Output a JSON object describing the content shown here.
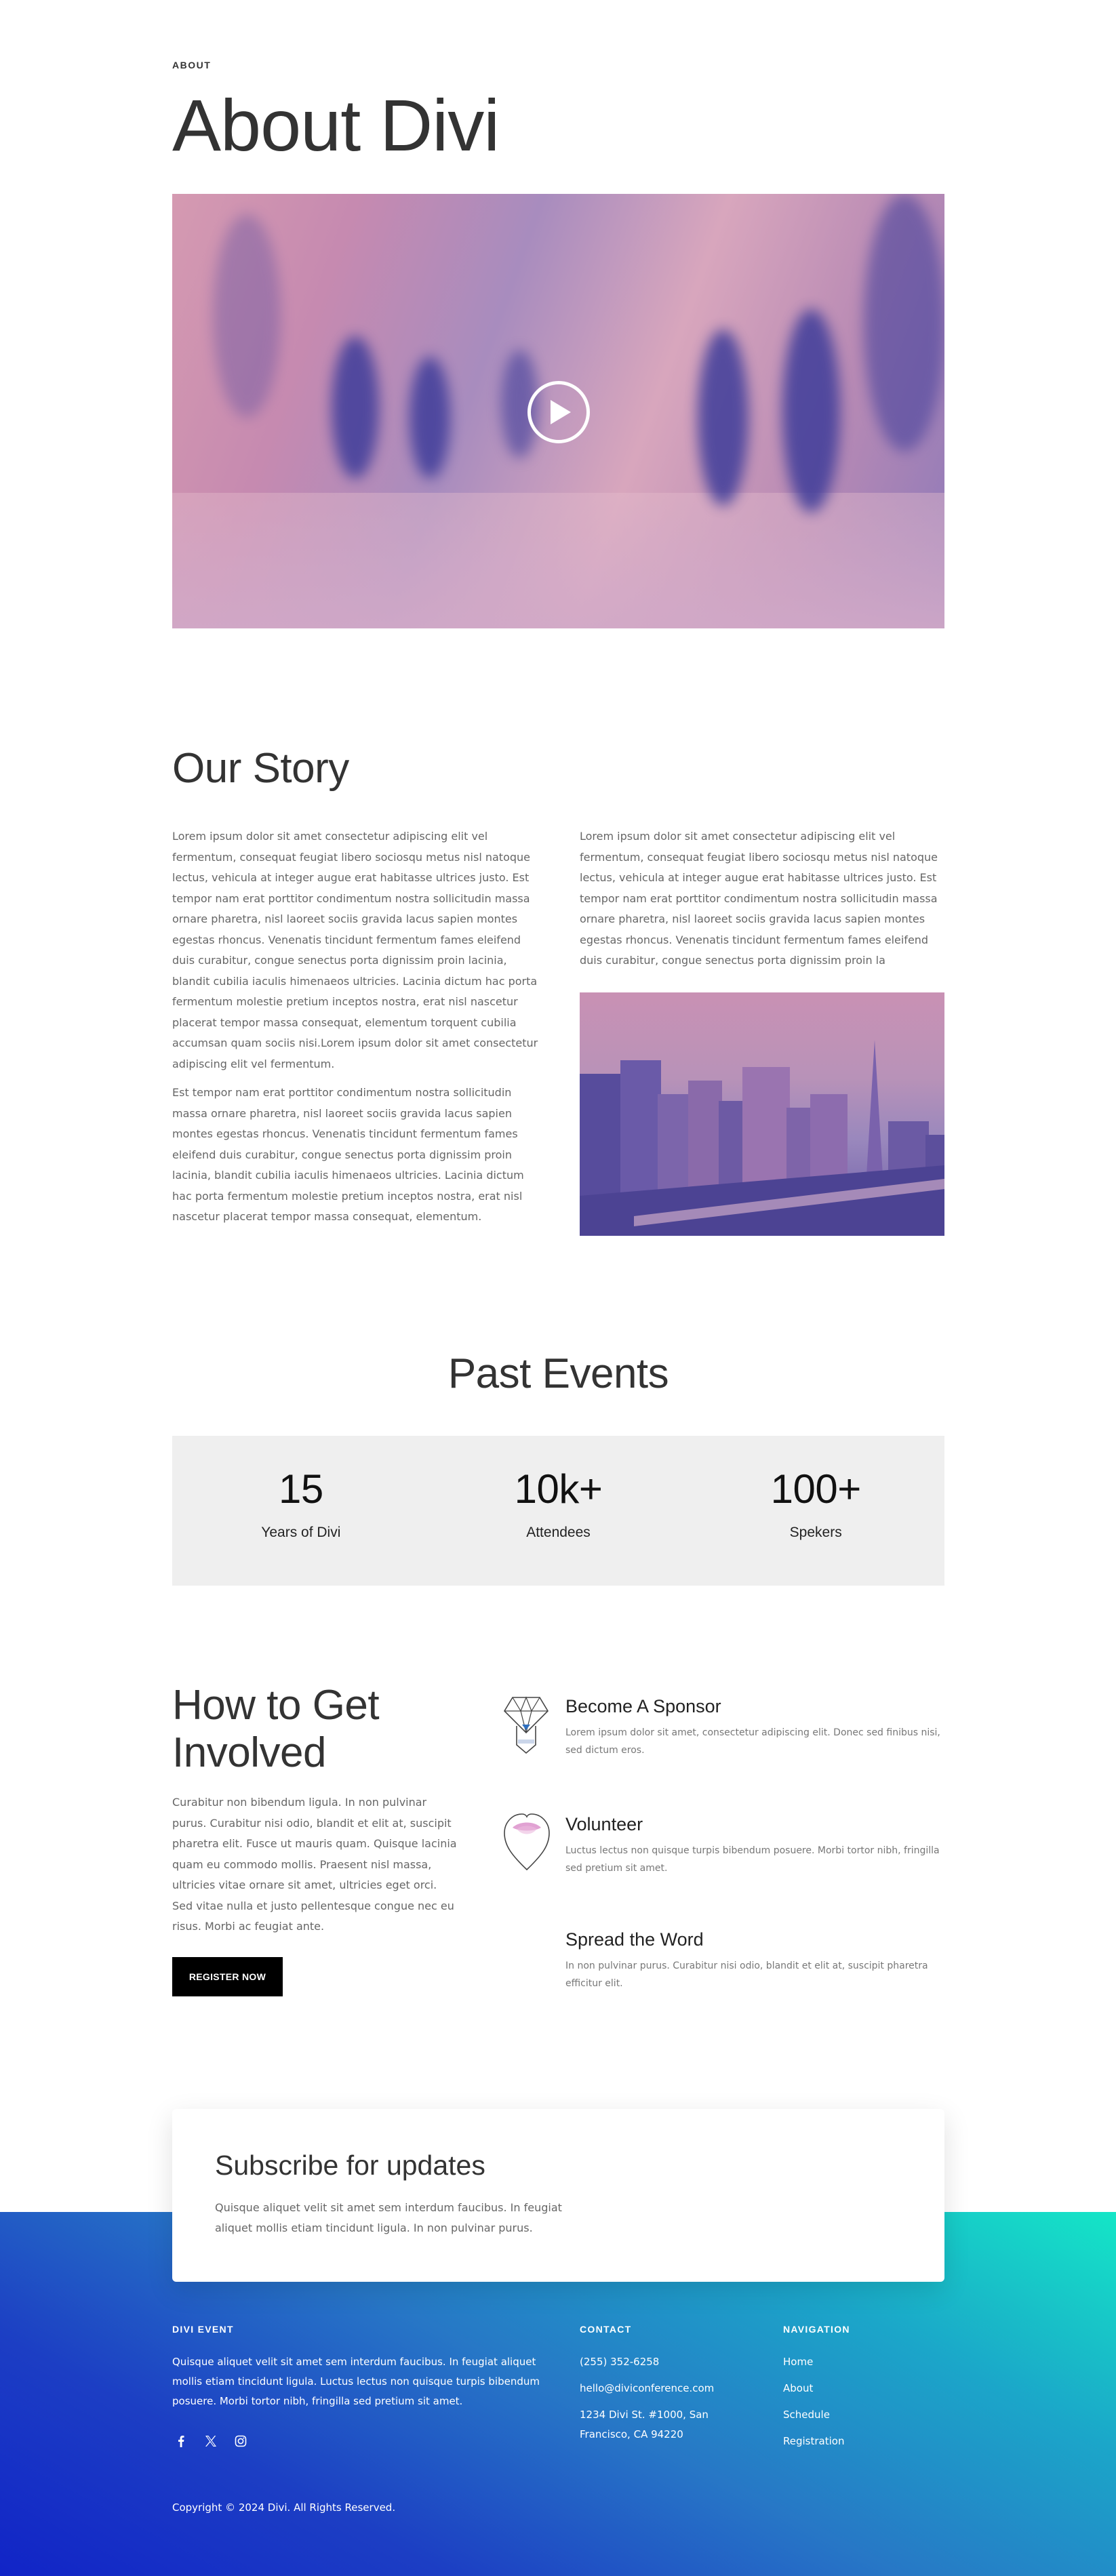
{
  "about": {
    "eyebrow": "ABOUT",
    "title": "About Divi",
    "video": {
      "play_icon": "play-icon"
    }
  },
  "story": {
    "title": "Our Story",
    "col1_p1": "Lorem ipsum dolor sit amet consectetur adipiscing elit vel fermentum, consequat feugiat libero sociosqu metus nisl natoque lectus, vehicula at integer augue erat habitasse ultrices justo. Est tempor nam erat porttitor condimentum nostra sollicitudin massa ornare pharetra, nisl laoreet sociis gravida lacus sapien montes egestas rhoncus. Venenatis tincidunt fermentum fames eleifend duis curabitur, congue senectus porta dignissim proin lacinia, blandit cubilia iaculis himenaeos ultricies. Lacinia dictum hac porta fermentum molestie pretium inceptos nostra, erat nisl nascetur placerat tempor massa consequat, elementum torquent cubilia accumsan quam sociis nisi.Lorem ipsum dolor sit amet consectetur adipiscing elit vel fermentum.",
    "col1_p2": "Est tempor nam erat porttitor condimentum nostra sollicitudin massa ornare pharetra, nisl laoreet sociis gravida lacus sapien montes egestas rhoncus. Venenatis tincidunt fermentum fames eleifend duis curabitur, congue senectus porta dignissim proin lacinia, blandit cubilia iaculis himenaeos ultricies. Lacinia dictum hac porta fermentum molestie pretium inceptos nostra, erat nisl nascetur placerat tempor massa consequat, elementum.",
    "col2_p1": "Lorem ipsum dolor sit amet consectetur adipiscing elit vel fermentum, consequat feugiat libero sociosqu metus nisl natoque lectus, vehicula at integer augue erat habitasse ultrices justo. Est tempor nam erat porttitor condimentum nostra sollicitudin massa ornare pharetra, nisl laoreet sociis gravida lacus sapien montes egestas rhoncus. Venenatis tincidunt fermentum fames eleifend duis curabitur, congue senectus porta dignissim proin la"
  },
  "events": {
    "title": "Past Events",
    "stats": [
      {
        "number": "15",
        "label": "Years of Divi"
      },
      {
        "number": "10k+",
        "label": "Attendees"
      },
      {
        "number": "100+",
        "label": "Spekers"
      }
    ]
  },
  "involved": {
    "title": "How to Get Involved",
    "text": "Curabitur non bibendum ligula. In non pulvinar purus. Curabitur nisi odio, blandit et elit at, suscipit pharetra elit. Fusce ut mauris quam. Quisque lacinia quam eu commodo mollis. Praesent nisl massa, ultricies vitae ornare sit amet, ultricies eget orci. Sed vitae nulla et justo pellentesque congue nec eu risus. Morbi ac feugiat ante.",
    "button": "REGISTER NOW",
    "items": [
      {
        "title": "Become A Sponsor",
        "text": "Lorem ipsum dolor sit amet, consectetur adipiscing elit. Donec sed finibus nisi, sed dictum eros.",
        "icon": "diamond-badge-icon"
      },
      {
        "title": "Volunteer",
        "text": "Luctus lectus non quisque turpis bibendum posuere. Morbi tortor nibh, fringilla sed pretium sit amet.",
        "icon": "heart-icon"
      },
      {
        "title": "Spread the Word",
        "text": "In non pulvinar purus. Curabitur nisi odio, blandit et elit at, suscipit pharetra efficitur elit.",
        "icon": ""
      }
    ]
  },
  "subscribe": {
    "title": "Subscribe for updates",
    "text": "Quisque aliquet velit sit amet sem interdum faucibus. In feugiat aliquet mollis etiam tincidunt ligula. In non pulvinar purus."
  },
  "footer": {
    "about_heading": "DIVI EVENT",
    "about_text": "Quisque aliquet velit sit amet sem interdum faucibus. In feugiat aliquet mollis etiam tincidunt ligula. Luctus lectus non quisque turpis bibendum posuere. Morbi tortor nibh, fringilla sed pretium sit amet.",
    "contact_heading": "CONTACT",
    "phone": "(255) 352-6258",
    "email": "hello@diviconference.com",
    "address": "1234 Divi St. #1000, San Francisco, CA 94220",
    "nav_heading": "NAVIGATION",
    "nav": [
      "Home",
      "About",
      "Schedule",
      "Registration"
    ],
    "socials": [
      "facebook-icon",
      "x-twitter-icon",
      "instagram-icon"
    ],
    "copyright": "Copyright © 2024 Divi. All Rights Reserved."
  },
  "colors": {
    "accent_dark": "#000000",
    "gradient_start": "#1124c7",
    "gradient_end": "#14e6c7",
    "duotone_dark": "#3f3d9a",
    "duotone_light": "#d59ab1",
    "stats_bg": "#efefef"
  }
}
